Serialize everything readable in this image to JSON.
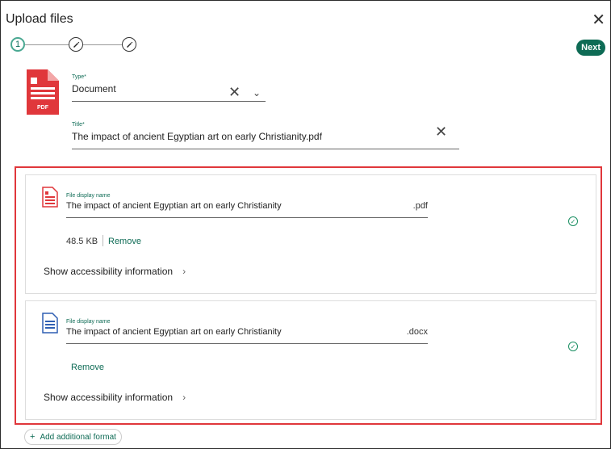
{
  "dialog": {
    "title": "Upload files",
    "close_icon": "close-icon"
  },
  "stepper": {
    "step1": "1",
    "step2_icon": "pencil-icon",
    "step3_icon": "pencil-icon"
  },
  "header": {
    "next_label": "Next"
  },
  "file_icon": {
    "badge": "PDF"
  },
  "type_field": {
    "label": "Type*",
    "value": "Document"
  },
  "title_field": {
    "label": "Title*",
    "value": "The impact of ancient Egyptian art on early Christianity.pdf"
  },
  "files": [
    {
      "label": "File display name",
      "value": "The impact of ancient Egyptian art on early Christianity",
      "ext": ".pdf",
      "size": "48.5 KB",
      "remove": "Remove",
      "accessibility": "Show accessibility information"
    },
    {
      "label": "File display name",
      "value": "The impact of ancient Egyptian art on early Christianity",
      "ext": ".docx",
      "remove": "Remove",
      "accessibility": "Show accessibility information"
    }
  ],
  "add_format": {
    "label": "Add additional format"
  },
  "colors": {
    "accent": "#0e6b55",
    "highlight_border": "#e0373b",
    "pdf_red": "#e0373b",
    "doc_blue": "#2f5fb3"
  }
}
